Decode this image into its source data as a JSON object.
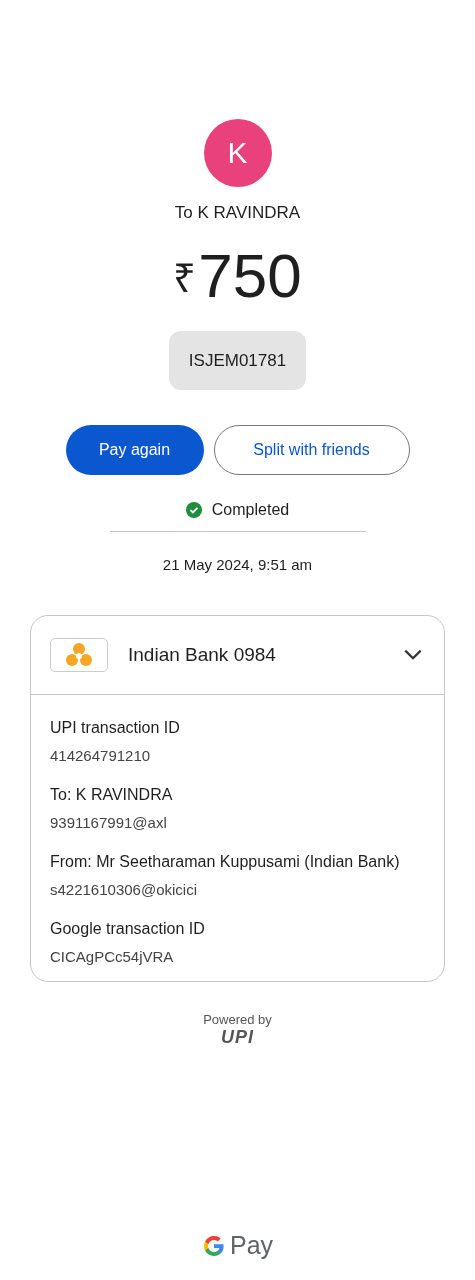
{
  "recipient": {
    "initial": "K",
    "title": "To K RAVINDRA"
  },
  "amount": {
    "currency": "₹",
    "value": "750"
  },
  "note": "ISJEM01781",
  "buttons": [
    {
      "label": "Pay again",
      "kind": "primary"
    },
    {
      "label": "Split with friends",
      "kind": "outline"
    }
  ],
  "status": {
    "label": "Completed",
    "completed": true
  },
  "datetime": "21 May 2024, 9:51 am",
  "details": {
    "bank": "Indian Bank 0984",
    "expanded": true,
    "rows": [
      {
        "label": "UPI transaction ID",
        "value": "414264791210"
      },
      {
        "label": "To: K RAVINDRA",
        "value": "9391167991@axl"
      },
      {
        "label": "From: Mr Seetharaman Kuppusami (Indian Bank)",
        "value": "s4221610306@okicici"
      },
      {
        "label": "Google transaction ID",
        "value": "CICAgPCc54jVRA"
      }
    ]
  },
  "footer": {
    "powered_by": "Powered by",
    "upi_logo": "UPI",
    "brand": "Pay"
  }
}
